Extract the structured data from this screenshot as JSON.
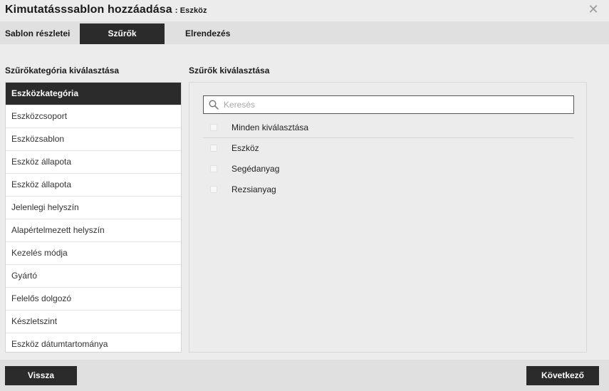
{
  "title": {
    "main": "Kimutatásssablon hozzáadása",
    "sub": ": Eszköz",
    "close_glyph": "✕"
  },
  "tabs": [
    {
      "label": "Sablon részletei",
      "active": false
    },
    {
      "label": "Szűrők",
      "active": true
    },
    {
      "label": "Elrendezés",
      "active": false
    }
  ],
  "left_panel": {
    "title": "Szűrőkategória kiválasztása",
    "items": [
      {
        "label": "Eszközkategória",
        "active": true
      },
      {
        "label": "Eszközcsoport"
      },
      {
        "label": "Eszközsablon"
      },
      {
        "label": "Eszköz állapota"
      },
      {
        "label": "Eszköz állapota"
      },
      {
        "label": "Jelenlegi helyszín"
      },
      {
        "label": "Alapértelmezett helyszín"
      },
      {
        "label": "Kezelés módja"
      },
      {
        "label": "Gyártó"
      },
      {
        "label": "Felelős dolgozó"
      },
      {
        "label": "Készletszint"
      },
      {
        "label": "Eszköz dátumtartománya"
      }
    ]
  },
  "right_panel": {
    "title": "Szűrők kiválasztása",
    "search": {
      "placeholder": "Keresés",
      "value": "",
      "icon": "search-icon"
    },
    "select_all": {
      "label": "Minden kiválasztása",
      "checked": false
    },
    "options": [
      {
        "label": "Eszköz",
        "checked": false
      },
      {
        "label": "Segédanyag",
        "checked": false
      },
      {
        "label": "Rezsianyag",
        "checked": false
      }
    ]
  },
  "footer": {
    "back_label": "Vissza",
    "next_label": "Következő"
  },
  "colors": {
    "accent_dark": "#2b2b2b",
    "background": "#ececec",
    "bar": "#e0e0e0"
  }
}
